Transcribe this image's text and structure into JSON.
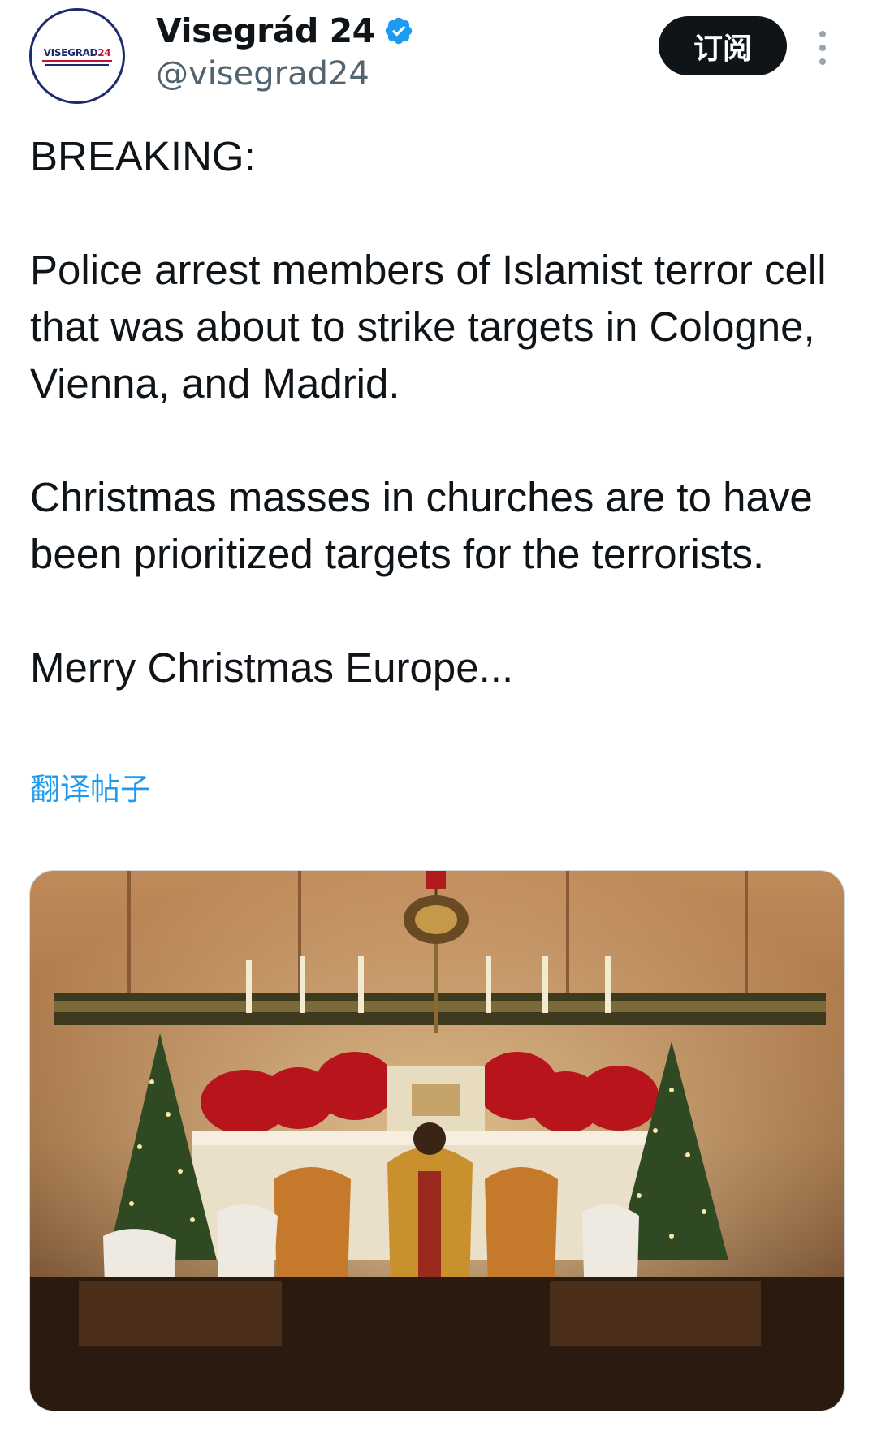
{
  "account": {
    "display_name": "Visegrád 24",
    "handle": "@visegrad24",
    "verified": true,
    "avatar_text_main": "VISEGRAD",
    "avatar_text_num": "24"
  },
  "subscribe_label": "订阅",
  "tweet": {
    "paragraphs": [
      "BREAKING:",
      "Police arrest members of Islamist terror cell that was about to strike targets in Cologne, Vienna, and Madrid.",
      "Christmas masses in churches are to have been prioritized targets for the terrorists.",
      "Merry Christmas Europe..."
    ]
  },
  "translate_link": "翻译帖子",
  "media": {
    "subject": "church-altar-christmas-mass"
  },
  "colors": {
    "accent": "#1d9bf0",
    "text": "#0f1419",
    "secondary": "#536471",
    "button": "#0f1419"
  },
  "icons": [
    "verified-badge-icon",
    "more-options-icon"
  ]
}
